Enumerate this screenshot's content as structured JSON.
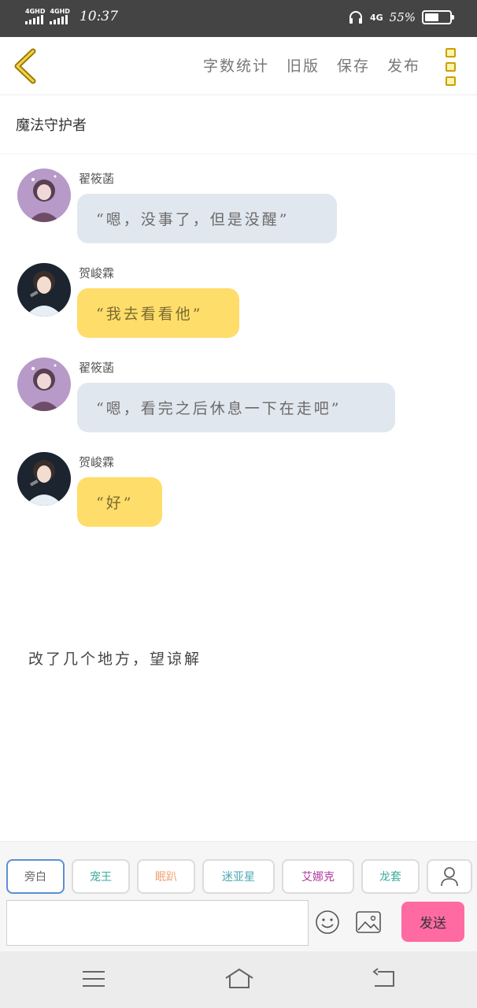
{
  "status_bar": {
    "sim1_label": "4GHD",
    "sim2_label": "4GHD",
    "time": "10:37",
    "network": "4G",
    "battery_text": "55%",
    "battery_level": 0.55
  },
  "topbar": {
    "actions": [
      "字数统计",
      "旧版",
      "保存",
      "发布"
    ],
    "accent_color": "#c9a100"
  },
  "title": "魔法守护者",
  "messages": [
    {
      "name": "翟筱菡",
      "text": "“嗯，没事了，但是没醒”",
      "style": "grey",
      "avatar": "girl-avatar"
    },
    {
      "name": "贺峻霖",
      "text": "“我去看看他”",
      "style": "yellow",
      "avatar": "boy-avatar"
    },
    {
      "name": "翟筱菡",
      "text": "“嗯，看完之后休息一下在走吧”",
      "style": "grey",
      "avatar": "girl-avatar"
    },
    {
      "name": "贺峻霖",
      "text": "“好”",
      "style": "yellow",
      "avatar": "boy-avatar"
    }
  ],
  "note": "改了几个地方，望谅解",
  "roles": [
    {
      "label": "旁白",
      "color": "#666666",
      "active": true
    },
    {
      "label": "宠王",
      "color": "#3aa9a0",
      "active": false
    },
    {
      "label": "眠趴",
      "color": "#f0a070",
      "active": false
    },
    {
      "label": "迷亚星",
      "color": "#4aa7b5",
      "active": false
    },
    {
      "label": "艾娜克",
      "color": "#b03aa0",
      "active": false
    },
    {
      "label": "龙套",
      "color": "#3aa9a0",
      "active": false
    }
  ],
  "composer": {
    "value": "",
    "send_label": "发送"
  },
  "colors": {
    "bubble_grey": "#e1e7ee",
    "bubble_yellow": "#ffdd6b",
    "send_button": "#ff6aa2"
  }
}
